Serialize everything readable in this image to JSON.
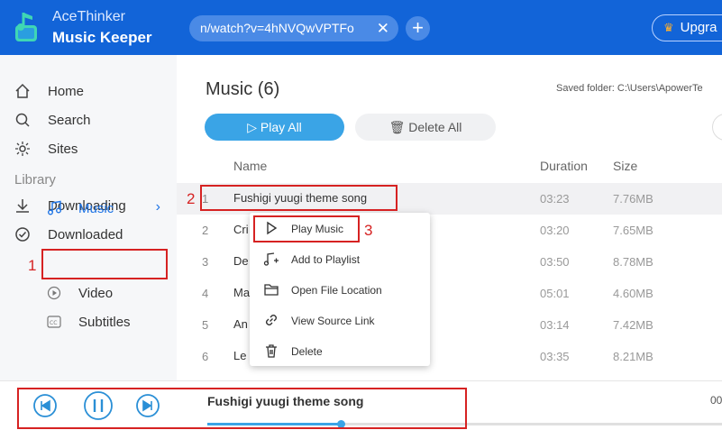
{
  "header": {
    "brand_line1": "AceThinker",
    "brand_line2": "Music Keeper",
    "url_tab": "n/watch?v=4hNVQwVPTFo",
    "url_close": "✕",
    "add_tab": "+",
    "upgrade_label": "Upgra",
    "upgrade_icon": "crown-icon",
    "accent": "#1264d8"
  },
  "sidebar": {
    "home": "Home",
    "search": "Search",
    "sites": "Sites",
    "library_label": "Library",
    "downloading": "Downloading",
    "downloaded": "Downloaded",
    "music": "Music",
    "video": "Video",
    "subtitles": "Subtitles"
  },
  "main": {
    "title": "Music (6)",
    "saved_folder": "Saved folder: C:\\Users\\ApowerTe",
    "play_all": "Play All",
    "delete_all": "Delete All",
    "columns": {
      "name": "Name",
      "duration": "Duration",
      "size": "Size"
    },
    "rows": [
      {
        "num": "1",
        "title": "Fushigi yuugi theme song",
        "duration": "03:23",
        "size": "7.76MB"
      },
      {
        "num": "2",
        "title": "Cri                                om - Drive Awa...",
        "duration": "03:20",
        "size": "7.65MB"
      },
      {
        "num": "3",
        "title": "De                                zen\") (Official Vi...",
        "duration": "03:50",
        "size": "8.78MB"
      },
      {
        "num": "4",
        "title": "Ma                               deo)",
        "duration": "05:01",
        "size": "4.60MB"
      },
      {
        "num": "5",
        "title": "An",
        "duration": "03:14",
        "size": "7.42MB"
      },
      {
        "num": "6",
        "title": "Le                                 c Video)",
        "duration": "03:35",
        "size": "8.21MB"
      }
    ]
  },
  "context_menu": {
    "items": [
      {
        "label": "Play Music",
        "icon": "play-icon"
      },
      {
        "label": "Add to Playlist",
        "icon": "add-playlist-icon"
      },
      {
        "label": "Open File Location",
        "icon": "folder-icon"
      },
      {
        "label": "View Source Link",
        "icon": "link-icon"
      },
      {
        "label": "Delete",
        "icon": "trash-icon"
      }
    ]
  },
  "annotations": {
    "n1": "1",
    "n2": "2",
    "n3": "3"
  },
  "player": {
    "now_playing": "Fushigi yuugi theme song",
    "progress": 0.26,
    "time_right": "00"
  }
}
